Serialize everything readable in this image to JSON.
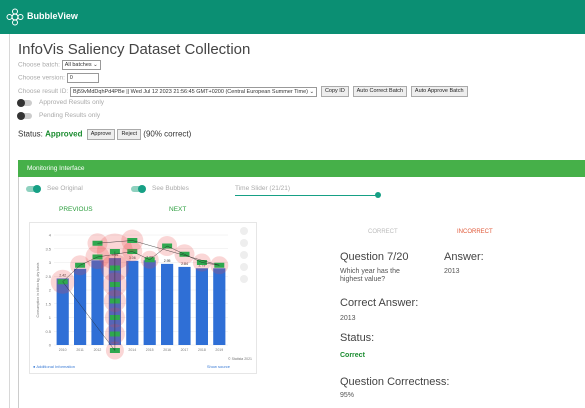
{
  "app": {
    "brand": "BubbleView"
  },
  "page": {
    "title": "InfoVis Saliency Dataset Collection"
  },
  "controls": {
    "batch_label": "Choose batch:",
    "batch_value": "All batches",
    "version_label": "Choose version:",
    "version_value": "0",
    "result_label": "Choose result ID:",
    "result_value": "Bj59vMdDqhPd4PBe || Wed Jul 12 2023 21:56:45 GMT+0200 (Central European Summer Time)",
    "copy_id": "Copy ID",
    "auto_correct": "Auto Correct Batch",
    "auto_approve": "Auto Approve Batch",
    "approved_only": "Approved Results only",
    "pending_only": "Pending Results only"
  },
  "status": {
    "label": "Status:",
    "value": "Approved",
    "approve": "Approve",
    "reject": "Reject",
    "percent_text": "(90% correct)"
  },
  "monitor": {
    "title": "Monitoring Interface",
    "see_original": "See Original",
    "see_bubbles": "See Bubbles",
    "time_slider": "Time Slider (21/21)",
    "slider_level": 1.0,
    "previous": "PREVIOUS",
    "next": "NEXT",
    "correct_tab": "CORRECT",
    "incorrect_tab": "INCORRECT"
  },
  "question": {
    "heading": "Question 7/20",
    "text": "Which year has the highest value?",
    "answer_label": "Answer:",
    "answer_value": "2013",
    "correct_answer_label": "Correct Answer:",
    "correct_answer_value": "2013",
    "status_label": "Status:",
    "status_value": "Correct",
    "correctness_label": "Question Correctness:",
    "correctness_value": "95%"
  },
  "chart_footer": {
    "left": "Additional Information",
    "right": "Show source",
    "credit": "© Statista 2021"
  },
  "chart_data": {
    "type": "bar",
    "categories": [
      "2010",
      "2011",
      "2012",
      "2013",
      "2014",
      "2015",
      "2016",
      "2017",
      "2018",
      "2019"
    ],
    "values": [
      2.42,
      2.77,
      3.08,
      3.16,
      3.06,
      3.08,
      2.95,
      2.84,
      2.79,
      2.79
    ],
    "ylim": [
      0,
      4
    ],
    "yticks": [
      0,
      0.5,
      1,
      1.5,
      2,
      2.5,
      3,
      3.5,
      4
    ],
    "ylabel": "Consumption in billion kg, dry basis",
    "colors": {
      "bar": "#2f6fd6",
      "bubble": "#e84545",
      "label_bg": "#2fa84f"
    }
  }
}
